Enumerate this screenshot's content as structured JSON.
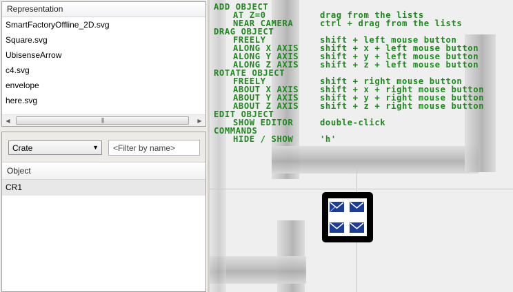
{
  "representation_panel": {
    "header": "Representation",
    "items": [
      "SmartFactoryOffline_2D.svg",
      "Square.svg",
      "UbisenseArrow",
      "c4.svg",
      "envelope",
      "here.svg"
    ],
    "scrollbar_grip": "|||"
  },
  "object_panel": {
    "type_select": "Crate",
    "filter_placeholder": "<Filter by name>",
    "header": "Object",
    "items": [
      "CR1"
    ]
  },
  "viewport": {
    "help_color": "#1a8c1a",
    "help": [
      {
        "key": "ADD OBJECT",
        "value": "",
        "level": "section"
      },
      {
        "key": "AT Z=0",
        "value": "drag from the lists",
        "level": "item"
      },
      {
        "key": "NEAR CAMERA",
        "value": "ctrl + drag from the lists",
        "level": "item"
      },
      {
        "key": "DRAG OBJECT",
        "value": "",
        "level": "section"
      },
      {
        "key": "FREELY",
        "value": "shift + left mouse button",
        "level": "item"
      },
      {
        "key": "ALONG X AXIS",
        "value": "shift + x + left mouse button",
        "level": "item"
      },
      {
        "key": "ALONG Y AXIS",
        "value": "shift + y + left mouse button",
        "level": "item"
      },
      {
        "key": "ALONG Z AXIS",
        "value": "shift + z + left mouse button",
        "level": "item"
      },
      {
        "key": "ROTATE OBJECT",
        "value": "",
        "level": "section"
      },
      {
        "key": "FREELY",
        "value": "shift + right mouse button",
        "level": "item"
      },
      {
        "key": "ABOUT X AXIS",
        "value": "shift + x + right mouse button",
        "level": "item"
      },
      {
        "key": "ABOUT Y AXIS",
        "value": "shift + y + right mouse button",
        "level": "item"
      },
      {
        "key": "ABOUT Z AXIS",
        "value": "shift + z + right mouse button",
        "level": "item"
      },
      {
        "key": "EDIT OBJECT",
        "value": "",
        "level": "section"
      },
      {
        "key": "SHOW EDITOR",
        "value": "double-click",
        "level": "item"
      },
      {
        "key": "COMMANDS",
        "value": "",
        "level": "section"
      },
      {
        "key": "HIDE / SHOW",
        "value": "'h'",
        "level": "item"
      }
    ],
    "crate_icons": [
      "envelope-icon",
      "envelope-icon",
      "envelope-icon",
      "envelope-icon"
    ],
    "envelope_color": "#1a3d9a"
  }
}
